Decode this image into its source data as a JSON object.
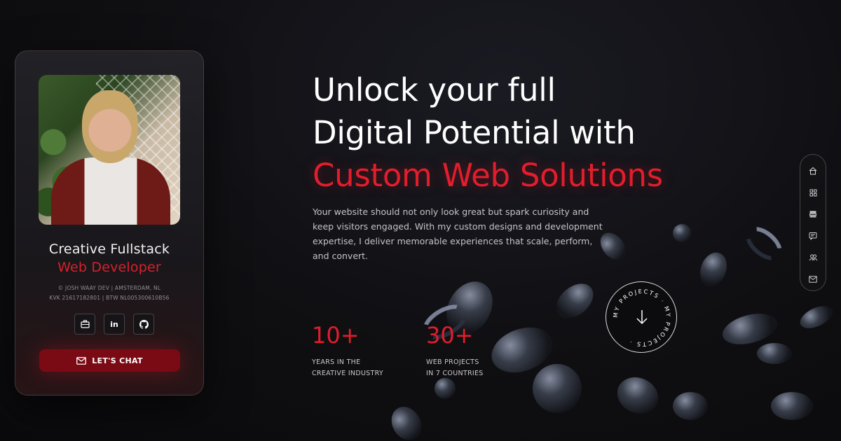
{
  "card": {
    "title": "Creative Fullstack",
    "subtitle": "Web Developer",
    "meta_line1": "© JOSH WAAY DEV | AMSTERDAM, NL",
    "meta_line2": "KVK 21617182801 | BTW NL005300610B56",
    "socials": [
      {
        "icon": "briefcase-icon"
      },
      {
        "icon": "linkedin-icon",
        "label": "in"
      },
      {
        "icon": "github-icon"
      }
    ],
    "cta_label": "LET'S CHAT"
  },
  "hero": {
    "line1": "Unlock your full",
    "line2": "Digital Potential with",
    "line3": "Custom Web Solutions",
    "description": "Your website should not only look great but spark curiosity and keep visitors engaged. With my custom designs and development expertise, I deliver memorable experiences that scale, perform, and convert."
  },
  "stats": [
    {
      "value": "10+",
      "label_line1": "YEARS IN THE",
      "label_line2": "CREATIVE INDUSTRY"
    },
    {
      "value": "30+",
      "label_line1": "WEB PROJECTS",
      "label_line2": "IN 7 COUNTRIES"
    }
  ],
  "badge": {
    "text": "MY PROJECTS · MY PROJECTS ·",
    "icon": "arrow-down-icon"
  },
  "rail": [
    {
      "icon": "home-icon"
    },
    {
      "icon": "grid-icon"
    },
    {
      "icon": "server-icon"
    },
    {
      "icon": "chat-icon"
    },
    {
      "icon": "users-icon"
    },
    {
      "icon": "mail-icon"
    }
  ],
  "colors": {
    "accent": "#e21d2c",
    "button": "#7a0a14",
    "background": "#0f0f12"
  }
}
